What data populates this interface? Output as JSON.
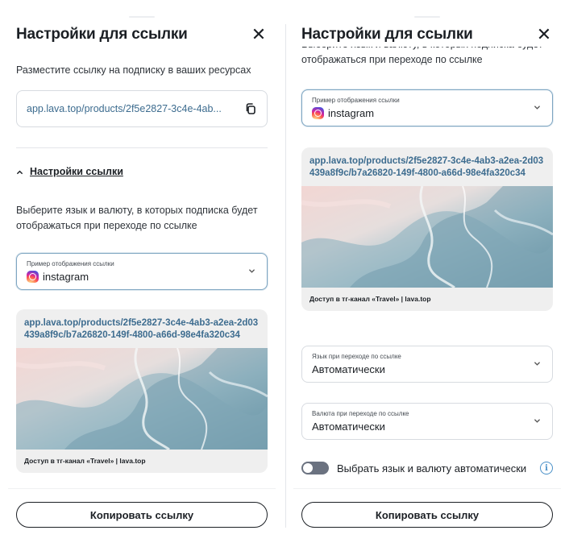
{
  "left": {
    "title": "Настройки для ссылки",
    "close": "✕",
    "placement_text": "Разместите ссылку на подписку в ваших ресурсах",
    "link_value": "app.lava.top/products/2f5e2827-3c4e-4ab...",
    "settings_toggle": "Настройки ссылки",
    "language_currency_text": "Выберите язык и валюту, в которых подписка будет отображаться при переходе по ссылке",
    "display_select": {
      "label": "Пример отображения ссылки",
      "value": "instagram"
    },
    "preview": {
      "link": "app.lava.top/products/2f5e2827-3c4e-4ab3-a2ea-2d03439a8f9c/b7a26820-149f-4800-a66d-98e4fa320c34",
      "caption": "Доступ в тг-канал «Travel» | lava.top"
    },
    "button": "Копировать ссылку"
  },
  "right": {
    "title": "Настройки для ссылки",
    "close": "✕",
    "language_currency_text": "Выберите язык и валюту, в которых подписка будет отображаться при переходе по ссылке",
    "display_select": {
      "label": "Пример отображения ссылки",
      "value": "instagram"
    },
    "preview": {
      "link": "app.lava.top/products/2f5e2827-3c4e-4ab3-a2ea-2d03439a8f9c/b7a26820-149f-4800-a66d-98e4fa320c34",
      "caption": "Доступ в тг-канал «Travel» | lava.top"
    },
    "language_select": {
      "label": "Язык при переходе по ссылке",
      "value": "Автоматически"
    },
    "currency_select": {
      "label": "Валюта при переходе по ссылке",
      "value": "Автоматически"
    },
    "auto_toggle": {
      "label": "Выбрать язык и валюту автоматически",
      "on": false
    },
    "info_icon_glyph": "i",
    "button": "Копировать ссылку"
  },
  "colors": {
    "link": "#3d6c8f",
    "accent_border": "#7fa6c2",
    "info": "#4a90c8",
    "toggle_off": "#6b7280"
  },
  "icons": [
    "close-icon",
    "copy-icon",
    "chevron-up-icon",
    "chevron-down-icon",
    "instagram-icon",
    "info-icon"
  ]
}
